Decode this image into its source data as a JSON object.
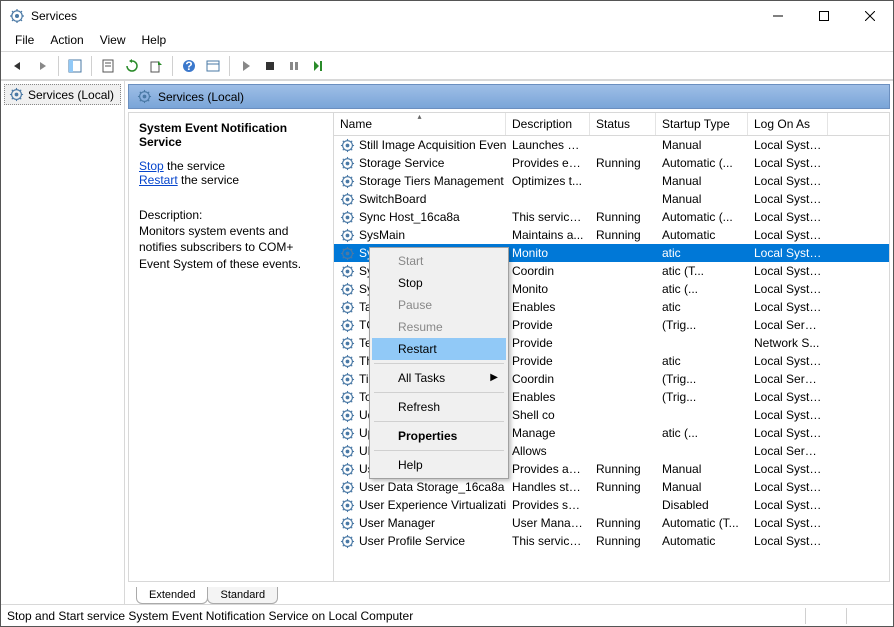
{
  "window": {
    "title": "Services"
  },
  "menubar": [
    "File",
    "Action",
    "View",
    "Help"
  ],
  "left": {
    "item": "Services (Local)"
  },
  "pane_header": "Services (Local)",
  "detail": {
    "title": "System Event Notification Service",
    "links": {
      "stop": "Stop",
      "restart": "Restart",
      "tail": " the service"
    },
    "desc_label": "Description:",
    "desc_text": "Monitors system events and notifies subscribers to COM+ Event System of these events."
  },
  "columns": [
    "Name",
    "Description",
    "Status",
    "Startup Type",
    "Log On As"
  ],
  "rows": [
    {
      "name": "Still Image Acquisition Events",
      "desc": "Launches a...",
      "status": "",
      "startup": "Manual",
      "logon": "Local Syste..."
    },
    {
      "name": "Storage Service",
      "desc": "Provides en...",
      "status": "Running",
      "startup": "Automatic (...",
      "logon": "Local Syste..."
    },
    {
      "name": "Storage Tiers Management",
      "desc": "Optimizes t...",
      "status": "",
      "startup": "Manual",
      "logon": "Local Syste..."
    },
    {
      "name": "SwitchBoard",
      "desc": "",
      "status": "",
      "startup": "Manual",
      "logon": "Local Syste..."
    },
    {
      "name": "Sync Host_16ca8a",
      "desc": "This service ...",
      "status": "Running",
      "startup": "Automatic (...",
      "logon": "Local Syste..."
    },
    {
      "name": "SysMain",
      "desc": "Maintains a...",
      "status": "Running",
      "startup": "Automatic",
      "logon": "Local Syste..."
    },
    {
      "name": "System Event Notification S...",
      "desc": "Monito",
      "status": "",
      "startup": "atic",
      "logon": "Local Syste...",
      "selected": true
    },
    {
      "name": "System Events Broker",
      "desc": "Coordin",
      "status": "",
      "startup": "atic (T...",
      "logon": "Local Syste..."
    },
    {
      "name": "System Guard Runtime Mo...",
      "desc": "Monito",
      "status": "",
      "startup": "atic (...",
      "logon": "Local Syste..."
    },
    {
      "name": "Task Scheduler",
      "desc": "Enables",
      "status": "",
      "startup": "atic",
      "logon": "Local Syste..."
    },
    {
      "name": "TCP/IP NetBIOS Helper",
      "desc": "Provide",
      "status": "",
      "startup": "(Trig...",
      "logon": "Local Service"
    },
    {
      "name": "Telephony",
      "desc": "Provide",
      "status": "",
      "startup": "",
      "logon": "Network S..."
    },
    {
      "name": "Themes",
      "desc": "Provide",
      "status": "",
      "startup": "atic",
      "logon": "Local Syste..."
    },
    {
      "name": "Time Broker",
      "desc": "Coordin",
      "status": "",
      "startup": "(Trig...",
      "logon": "Local Service"
    },
    {
      "name": "Touch Keyboard and Hand...",
      "desc": "Enables",
      "status": "",
      "startup": "(Trig...",
      "logon": "Local Syste..."
    },
    {
      "name": "Udk User Service_16ca8a",
      "desc": "Shell co",
      "status": "",
      "startup": "",
      "logon": "Local Syste..."
    },
    {
      "name": "Update Orchestrator Service",
      "desc": "Manage",
      "status": "",
      "startup": "atic (...",
      "logon": "Local Syste..."
    },
    {
      "name": "UPnP Device Host",
      "desc": "Allows ",
      "status": "",
      "startup": "",
      "logon": "Local Service"
    },
    {
      "name": "User Data Access_16ca8a",
      "desc": "Provides ap...",
      "status": "Running",
      "startup": "Manual",
      "logon": "Local Syste..."
    },
    {
      "name": "User Data Storage_16ca8a",
      "desc": "Handles sto...",
      "status": "Running",
      "startup": "Manual",
      "logon": "Local Syste..."
    },
    {
      "name": "User Experience Virtualizati...",
      "desc": "Provides su...",
      "status": "",
      "startup": "Disabled",
      "logon": "Local Syste..."
    },
    {
      "name": "User Manager",
      "desc": "User Manag...",
      "status": "Running",
      "startup": "Automatic (T...",
      "logon": "Local Syste..."
    },
    {
      "name": "User Profile Service",
      "desc": "This service ...",
      "status": "Running",
      "startup": "Automatic",
      "logon": "Local Syste..."
    }
  ],
  "context_menu": {
    "start": "Start",
    "stop": "Stop",
    "pause": "Pause",
    "resume": "Resume",
    "restart": "Restart",
    "alltasks": "All Tasks",
    "refresh": "Refresh",
    "properties": "Properties",
    "help": "Help"
  },
  "tabs": {
    "extended": "Extended",
    "standard": "Standard"
  },
  "status": "Stop and Start service System Event Notification Service on Local Computer"
}
